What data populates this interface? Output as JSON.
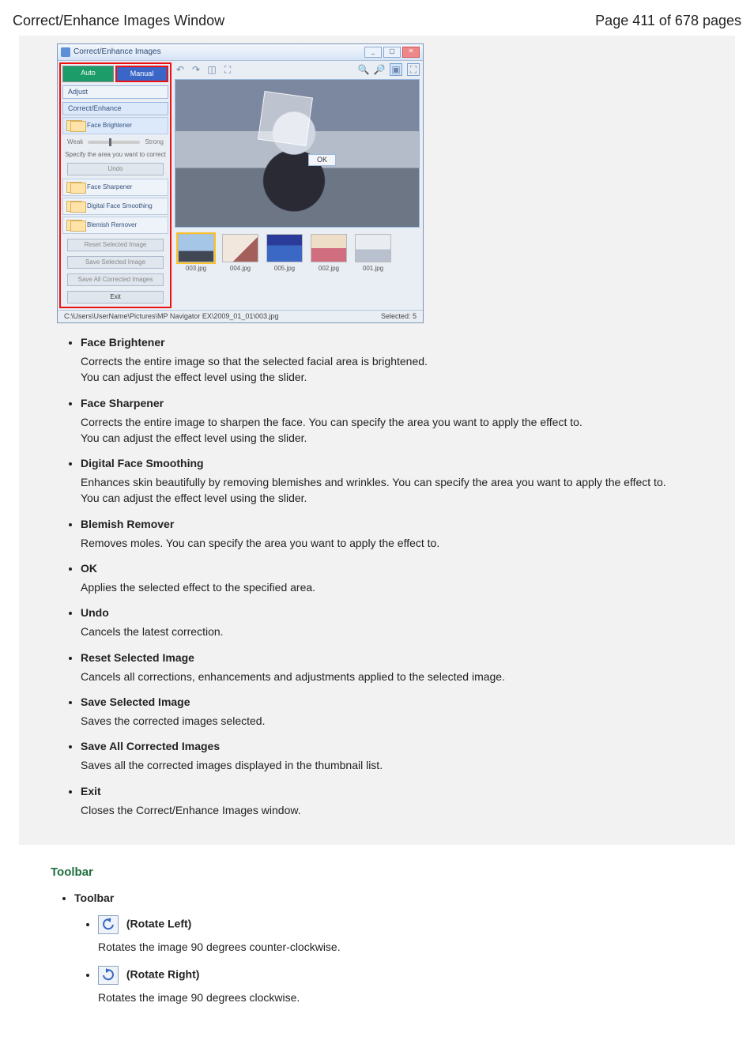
{
  "header": {
    "title": "Correct/Enhance Images Window",
    "pager": "Page 411 of 678 pages"
  },
  "app": {
    "title": "Correct/Enhance Images",
    "mode_auto": "Auto",
    "mode_manual": "Manual",
    "tab_adjust": "Adjust",
    "tab_correct": "Correct/Enhance",
    "enh_face_brightener": "Face Brightener",
    "enh_face_sharpener": "Face Sharpener",
    "enh_digital_face_smoothing": "Digital Face Smoothing",
    "enh_blemish_remover": "Blemish Remover",
    "weak": "Weak",
    "strong": "Strong",
    "slider_ticks": "1   2   3",
    "specify_instr": "Specify the area you want to correct",
    "undo_btn": "Undo",
    "reset_btn": "Reset Selected Image",
    "save_sel_btn": "Save Selected Image",
    "save_all_btn": "Save All Corrected Images",
    "exit_btn": "Exit",
    "ok_btn": "OK",
    "thumbs": [
      {
        "label": "003.jpg"
      },
      {
        "label": "004.jpg"
      },
      {
        "label": "005.jpg"
      },
      {
        "label": "002.jpg"
      },
      {
        "label": "001.jpg"
      }
    ],
    "status_path": "C:\\Users\\UserName\\Pictures\\MP Navigator EX\\2009_01_01\\003.jpg",
    "status_sel": "Selected: 5"
  },
  "defs": [
    {
      "term": "Face Brightener",
      "desc": "Corrects the entire image so that the selected facial area is brightened.\nYou can adjust the effect level using the slider."
    },
    {
      "term": "Face Sharpener",
      "desc": "Corrects the entire image to sharpen the face. You can specify the area you want to apply the effect to.\nYou can adjust the effect level using the slider."
    },
    {
      "term": "Digital Face Smoothing",
      "desc": "Enhances skin beautifully by removing blemishes and wrinkles. You can specify the area you want to apply the effect to.\nYou can adjust the effect level using the slider."
    },
    {
      "term": "Blemish Remover",
      "desc": "Removes moles. You can specify the area you want to apply the effect to."
    },
    {
      "term": "OK",
      "desc": "Applies the selected effect to the specified area."
    },
    {
      "term": "Undo",
      "desc": "Cancels the latest correction."
    },
    {
      "term": "Reset Selected Image",
      "desc": "Cancels all corrections, enhancements and adjustments applied to the selected image."
    },
    {
      "term": "Save Selected Image",
      "desc": "Saves the corrected images selected."
    },
    {
      "term": "Save All Corrected Images",
      "desc": "Saves all the corrected images displayed in the thumbnail list."
    },
    {
      "term": "Exit",
      "desc": "Closes the Correct/Enhance Images window."
    }
  ],
  "toolbar_section": {
    "heading": "Toolbar",
    "item_label": "Toolbar",
    "rotate_left": {
      "label": "(Rotate Left)",
      "desc": "Rotates the image 90 degrees counter-clockwise."
    },
    "rotate_right": {
      "label": "(Rotate Right)",
      "desc": "Rotates the image 90 degrees clockwise."
    }
  }
}
